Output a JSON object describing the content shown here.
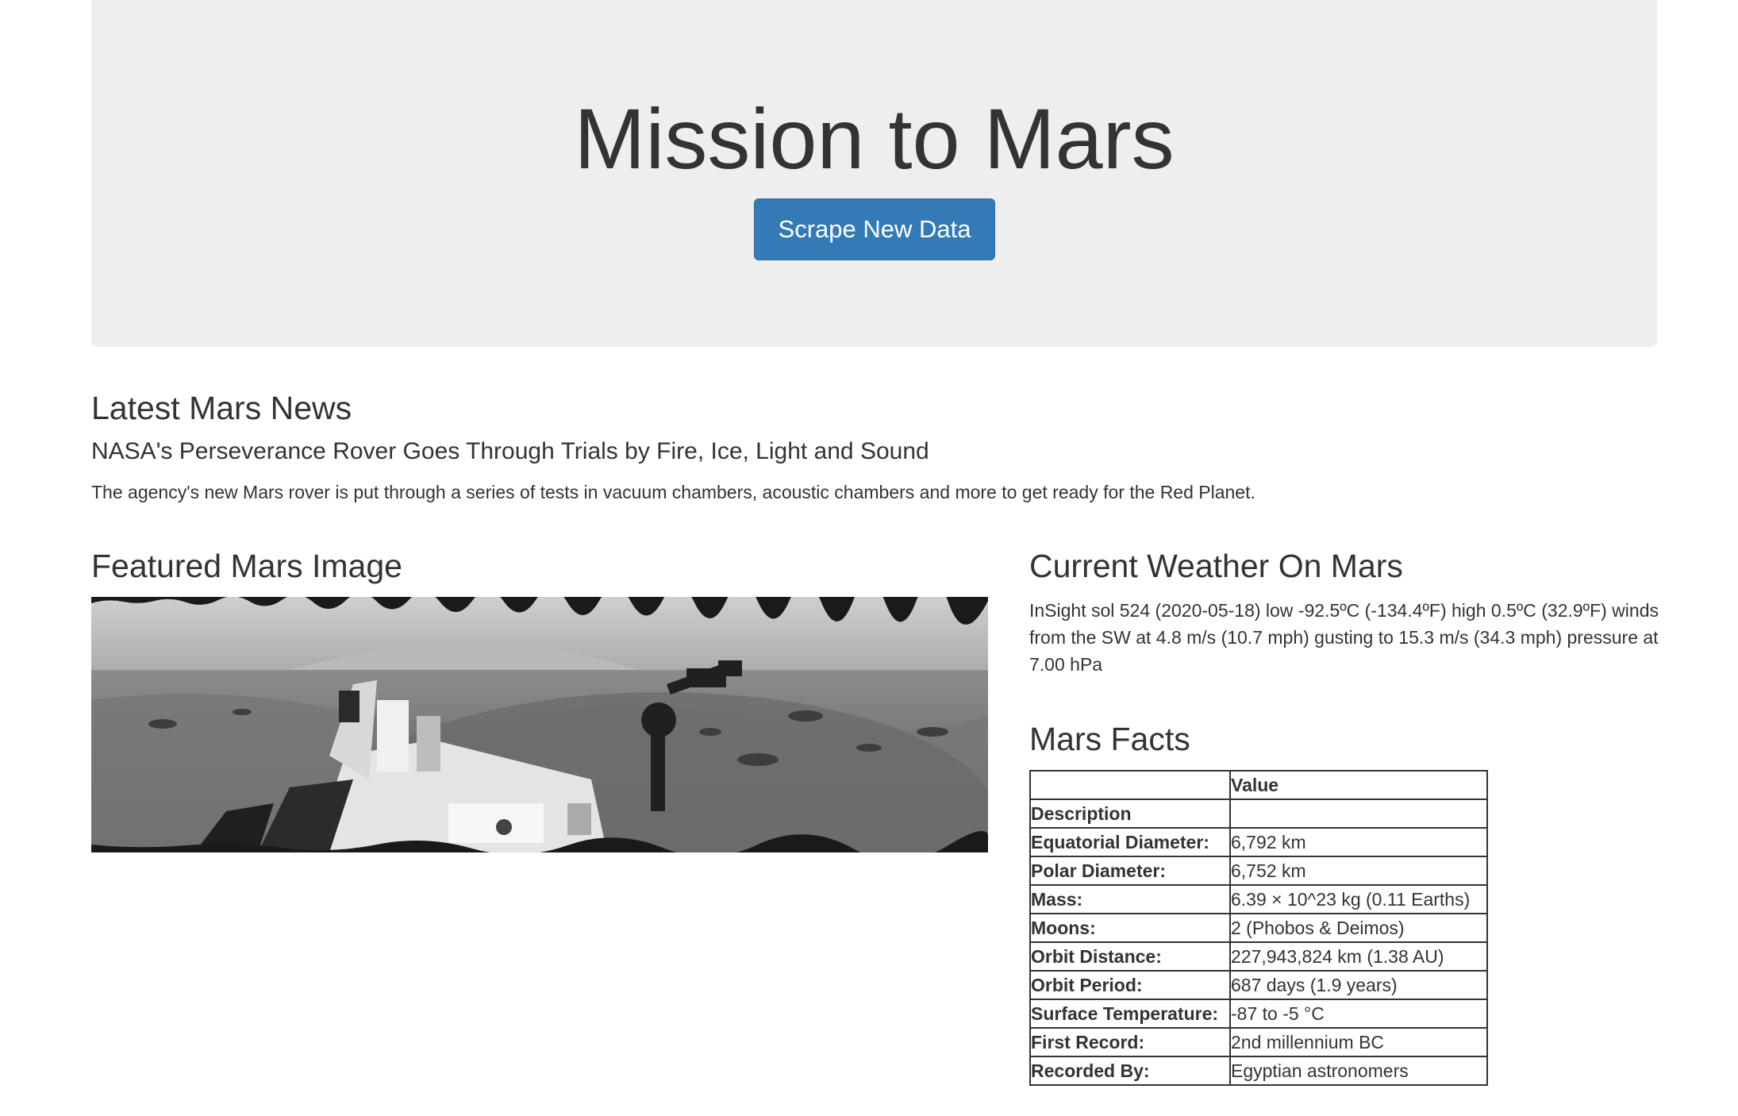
{
  "header": {
    "title": "Mission to Mars",
    "scrape_button_label": "Scrape New Data"
  },
  "news": {
    "section_title": "Latest Mars News",
    "headline": "NASA's Perseverance Rover Goes Through Trials by Fire, Ice, Light and Sound",
    "teaser": "The agency's new Mars rover is put through a series of tests in vacuum chambers, acoustic chambers and more to get ready for the Red Planet."
  },
  "featured_image": {
    "section_title": "Featured Mars Image"
  },
  "weather": {
    "section_title": "Current Weather On Mars",
    "text": "InSight sol 524 (2020-05-18) low -92.5ºC (-134.4ºF) high 0.5ºC (32.9ºF) winds from the SW at 4.8 m/s (10.7 mph) gusting to 15.3 m/s (34.3 mph) pressure at 7.00 hPa"
  },
  "facts": {
    "section_title": "Mars Facts",
    "header_blank": "",
    "header_value": "Value",
    "index_label": "Description",
    "rows": [
      {
        "label": "Equatorial Diameter:",
        "value": "6,792 km"
      },
      {
        "label": "Polar Diameter:",
        "value": "6,752 km"
      },
      {
        "label": "Mass:",
        "value": "6.39 × 10^23 kg (0.11 Earths)"
      },
      {
        "label": "Moons:",
        "value": "2 (Phobos & Deimos)"
      },
      {
        "label": "Orbit Distance:",
        "value": "227,943,824 km (1.38 AU)"
      },
      {
        "label": "Orbit Period:",
        "value": "687 days (1.9 years)"
      },
      {
        "label": "Surface Temperature:",
        "value": "-87 to -5 °C"
      },
      {
        "label": "First Record:",
        "value": "2nd millennium BC"
      },
      {
        "label": "Recorded By:",
        "value": "Egyptian astronomers"
      }
    ]
  }
}
